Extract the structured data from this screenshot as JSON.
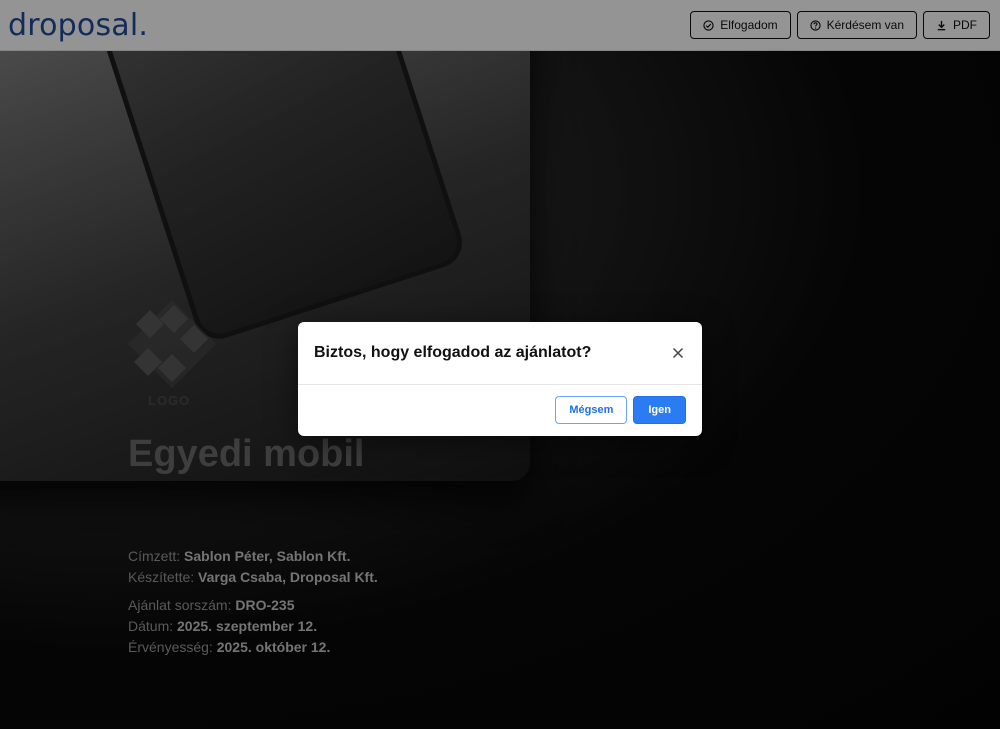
{
  "header": {
    "brand": "droposal",
    "brand_dot": ".",
    "buttons": [
      {
        "label": "Elfogadom",
        "icon": "check-circle-icon"
      },
      {
        "label": "Kérdésem van",
        "icon": "question-circle-icon"
      },
      {
        "label": "PDF",
        "icon": "download-icon"
      }
    ]
  },
  "hero": {
    "logo_text": "LOGO",
    "title": "Egyedi mobil"
  },
  "meta": {
    "recipient_label": "Címzett:",
    "recipient_value": "Sablon Péter, Sablon Kft.",
    "author_label": "Készítette:",
    "author_value": "Varga Csaba, Droposal Kft.",
    "offer_no_label": "Ajánlat sorszám:",
    "offer_no_value": "DRO-235",
    "date_label": "Dátum:",
    "date_value": "2025. szeptember 12.",
    "validity_label": "Érvényesség:",
    "validity_value": "2025. október 12."
  },
  "modal": {
    "title": "Biztos, hogy elfogadod az ajánlatot?",
    "cancel_label": "Mégsem",
    "confirm_label": "Igen",
    "close_icon": "close-icon"
  },
  "colors": {
    "brand": "#1f4d9a",
    "primary": "#2b7cf2",
    "overlay": "rgba(0,0,0,0.42)"
  }
}
